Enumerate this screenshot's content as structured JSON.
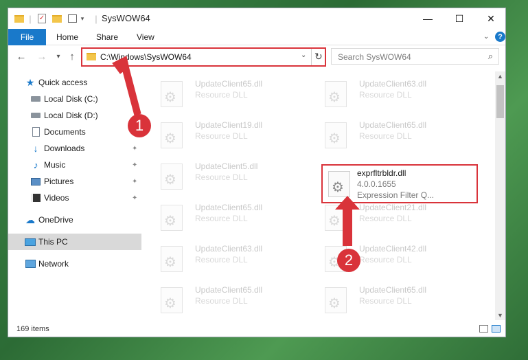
{
  "window": {
    "title": "SysWOW64",
    "controls": {
      "minimize": "—",
      "maximize": "☐",
      "close": "✕"
    }
  },
  "ribbon": {
    "file": "File",
    "tabs": [
      "Home",
      "Share",
      "View"
    ],
    "help": "?",
    "accent": "#1979ca"
  },
  "address": {
    "back": "←",
    "forward": "→",
    "recent": "▾",
    "up": "↑",
    "path": "C:\\Windows\\SysWOW64",
    "dropdown": "⌄",
    "refresh": "↻"
  },
  "search": {
    "placeholder": "Search SysWOW64",
    "icon": "⌕"
  },
  "sidebar": {
    "items": [
      {
        "label": "Quick access",
        "icon": "star-icon",
        "pinned": false
      },
      {
        "label": "Local Disk (C:)",
        "icon": "drive-icon",
        "pinned": true
      },
      {
        "label": "Local Disk (D:)",
        "icon": "drive-icon",
        "pinned": false
      },
      {
        "label": "Documents",
        "icon": "documents-icon",
        "pinned": true
      },
      {
        "label": "Downloads",
        "icon": "downloads-icon",
        "pinned": true
      },
      {
        "label": "Music",
        "icon": "music-icon",
        "pinned": true
      },
      {
        "label": "Pictures",
        "icon": "pictures-icon",
        "pinned": true
      },
      {
        "label": "Videos",
        "icon": "videos-icon",
        "pinned": true
      },
      {
        "label": "OneDrive",
        "icon": "onedrive-icon",
        "pinned": false
      },
      {
        "label": "This PC",
        "icon": "this-pc-icon",
        "pinned": false,
        "selected": true
      },
      {
        "label": "Network",
        "icon": "network-icon",
        "pinned": false
      }
    ],
    "pin_glyph": "📌"
  },
  "files": {
    "left": [
      {
        "name": "UpdateClient65.dll",
        "desc": "Resource DLL"
      },
      {
        "name": "UpdateClient19.dll",
        "desc": "Resource DLL"
      },
      {
        "name": "UpdateClient5.dll",
        "desc": "Resource DLL"
      },
      {
        "name": "UpdateClient65.dll",
        "desc": "Resource DLL"
      },
      {
        "name": "UpdateClient63.dll",
        "desc": "Resource DLL"
      },
      {
        "name": "UpdateClient65.dll",
        "desc": "Resource DLL"
      }
    ],
    "right": [
      {
        "name": "UpdateClient63.dll",
        "desc": "Resource DLL"
      },
      {
        "name": "UpdateClient65.dll",
        "desc": "Resource DLL"
      },
      {
        "name": "UpdateClient21.dll",
        "desc": "Resource DLL"
      },
      {
        "name": "UpdateClient42.dll",
        "desc": "Resource DLL"
      },
      {
        "name": "UpdateClient65.dll",
        "desc": "Resource DLL"
      }
    ],
    "highlighted": {
      "name": "exprfltrbldr.dll",
      "version": "4.0.0.1655",
      "description": "Expression Filter Q..."
    }
  },
  "status": {
    "count": "169 items"
  },
  "annotations": {
    "step1": "1",
    "step2": "2",
    "color": "#d9333a"
  }
}
